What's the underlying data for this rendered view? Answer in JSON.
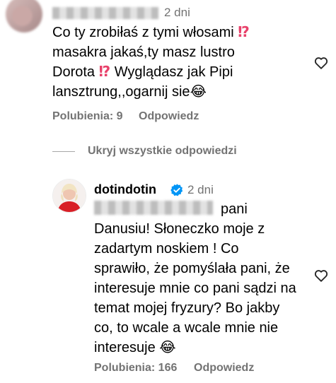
{
  "comment1": {
    "time": "2 dni",
    "lines": [
      "Co ty zrobiłaś z tymi włosami",
      "masakra jakaś,ty masz lustro",
      "Dorota",
      " Wyglądasz jak Pipi",
      "lansztrung,,ogarnij sie"
    ],
    "interrobang": "⁉",
    "laugh_emoji": "😂",
    "likes": "Polubienia: 9",
    "reply": "Odpowiedz"
  },
  "hide_replies": "Ukryj wszystkie odpowiedzi",
  "comment2": {
    "username": "dotindotin",
    "time": "2 dni",
    "lines": [
      "pani",
      "Danusiu! Słoneczko moje z",
      "zadartym noskiem ! Co",
      "sprawiło, że pomyślała pani, że",
      "interesuje mnie co pani sądzi na",
      "temat mojej fryzury? Bo jakby",
      "co, to wcale a wcale mnie nie",
      "interesuje"
    ],
    "laugh_emoji": "😂",
    "likes": "Polubienia: 166",
    "reply": "Odpowiedz"
  },
  "colors": {
    "secondary_text": "#737373",
    "verified_badge": "#0095f6",
    "interrobang": "#e8416a"
  },
  "icons": [
    "heart-outline-icon",
    "verified-badge-icon"
  ]
}
